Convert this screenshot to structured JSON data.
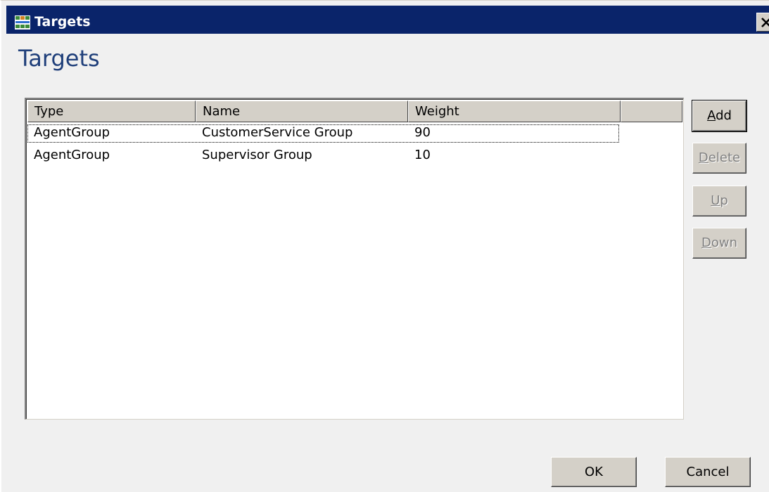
{
  "window": {
    "title": "Targets",
    "app_icon": "grid-app-icon",
    "close_icon": "close-icon"
  },
  "heading": "Targets",
  "table": {
    "columns": [
      "Type",
      "Name",
      "Weight"
    ],
    "rows": [
      {
        "type": "AgentGroup",
        "name": "CustomerService Group",
        "weight": "90",
        "focused": true
      },
      {
        "type": "AgentGroup",
        "name": "Supervisor Group",
        "weight": "10",
        "focused": false
      }
    ]
  },
  "side_buttons": {
    "add": {
      "prefix": "",
      "mnemonic": "A",
      "rest": "dd",
      "enabled": true
    },
    "delete": {
      "prefix": "",
      "mnemonic": "D",
      "rest": "elete",
      "enabled": false
    },
    "up": {
      "prefix": "",
      "mnemonic": "U",
      "rest": "p",
      "enabled": false
    },
    "down": {
      "prefix": "",
      "mnemonic": "D",
      "rest": "own",
      "enabled": false
    }
  },
  "footer": {
    "ok_label": "OK",
    "cancel_label": "Cancel"
  },
  "colors": {
    "title_bar": "#0a246a",
    "heading_text": "#1f3f7a",
    "dialog_bg": "#f0f0f0"
  }
}
